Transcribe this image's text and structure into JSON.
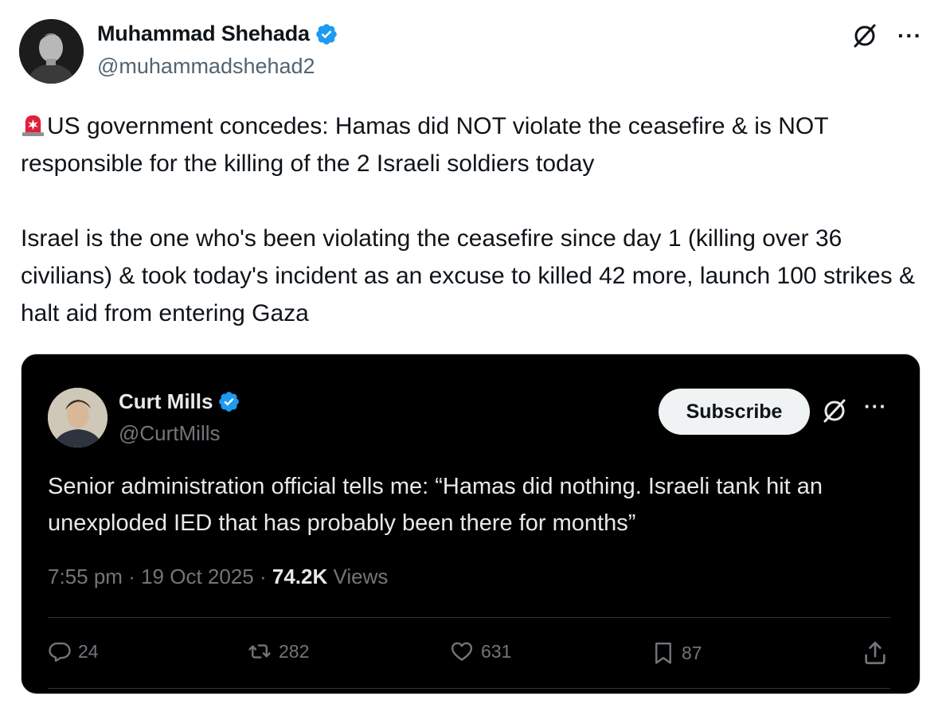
{
  "author": {
    "display_name": "Muhammad Shehada",
    "handle": "@muhammadshehad2",
    "verified": true
  },
  "icons": {
    "verified": "verified-badge-icon",
    "grok": "grok-icon",
    "more": "more-options-icon",
    "siren": "police-light-emoji",
    "reply": "reply-icon",
    "retweet": "retweet-icon",
    "like": "heart-icon",
    "bookmark": "bookmark-icon",
    "share": "share-icon"
  },
  "colors": {
    "verified_blue": "#1d9bf0",
    "text_primary": "#0f1419",
    "text_secondary": "#536471",
    "quote_bg": "#000000",
    "quote_text": "#e7e9ea",
    "quote_secondary": "#71767b"
  },
  "tweet": {
    "paragraph1": "US government concedes: Hamas did NOT violate the ceasefire & is NOT responsible for the killing of the 2 Israeli soldiers today",
    "paragraph2": "Israel is the one who's been violating the ceasefire since day 1 (killing over 36 civilians) & took today's incident as an excuse to killed 42 more, launch 100 strikes & halt aid from entering Gaza"
  },
  "quote": {
    "display_name": "Curt Mills",
    "handle": "@CurtMills",
    "verified": true,
    "subscribe_label": "Subscribe",
    "text": "Senior administration official tells me: “Hamas did nothing. Israeli tank hit an unexploded IED that has probably been there for months”",
    "time": "7:55 pm",
    "date": "19 Oct 2025",
    "views_count": "74.2K",
    "views_label": "Views",
    "separator": "·",
    "replies": "24",
    "retweets": "282",
    "likes": "631",
    "bookmarks": "87"
  }
}
